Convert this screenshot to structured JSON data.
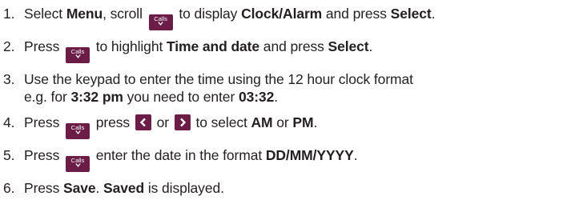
{
  "key": {
    "calls_label": "Calls",
    "color": "#6b1c47"
  },
  "steps": [
    {
      "num": "1.",
      "t1": "Select ",
      "b1": "Menu",
      "t2": ", scroll ",
      "t3": " to display ",
      "b2": "Clock/Alarm",
      "t4": " and press ",
      "b3": "Select",
      "t5": "."
    },
    {
      "num": "2.",
      "t1": "Press ",
      "t2": " to highlight ",
      "b1": "Time and date",
      "t3": " and press ",
      "b2": "Select",
      "t4": "."
    },
    {
      "num": "3.",
      "line1": "Use the keypad to enter the time using the 12 hour clock format",
      "t1": "e.g. for ",
      "b1": "3:32 pm",
      "t2": " you need to enter ",
      "b2": "03:32",
      "t3": "."
    },
    {
      "num": "4.",
      "t1": "Press ",
      "t2": " press ",
      "t3": " or ",
      "t4": " to select ",
      "b1": "AM",
      "t5": " or ",
      "b2": "PM",
      "t6": "."
    },
    {
      "num": "5.",
      "t1": "Press ",
      "t2": " enter the date in the format ",
      "b1": "DD/MM/YYYY",
      "t3": "."
    },
    {
      "num": "6.",
      "t1": "Press ",
      "b1": "Save",
      "t2": ". ",
      "b2": "Saved",
      "t3": " is displayed."
    }
  ]
}
